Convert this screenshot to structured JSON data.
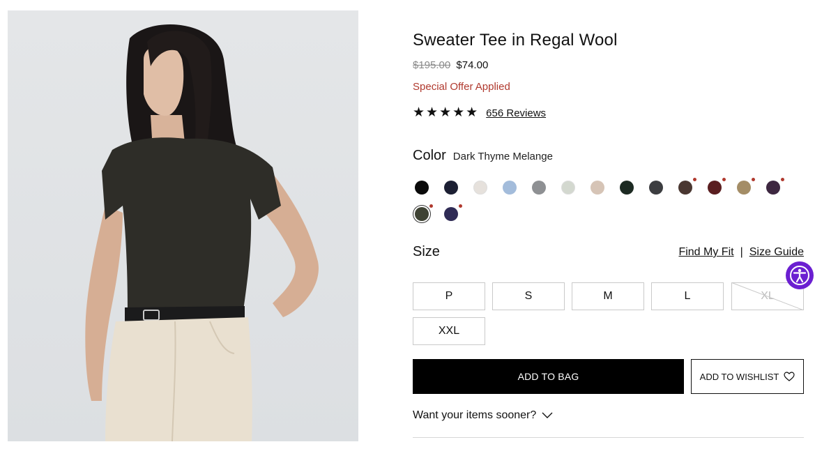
{
  "product": {
    "title": "Sweater Tee in Regal Wool",
    "price_original": "$195.00",
    "price_sale": "$74.00",
    "offer_text": "Special Offer Applied",
    "rating_stars": "★★★★★",
    "rating_value": 5,
    "reviews_link": "656 Reviews"
  },
  "color": {
    "label": "Color",
    "selected_name": "Dark Thyme Melange",
    "swatches": [
      {
        "color": "#0a0a0a",
        "dot": false,
        "selected": false
      },
      {
        "color": "#1c1f33",
        "dot": false,
        "selected": false
      },
      {
        "color": "#e6e1dc",
        "dot": false,
        "selected": false
      },
      {
        "color": "#a3bcdb",
        "dot": false,
        "selected": false
      },
      {
        "color": "#8e9093",
        "dot": false,
        "selected": false
      },
      {
        "color": "#d3d8cf",
        "dot": false,
        "selected": false
      },
      {
        "color": "#d6c4b6",
        "dot": false,
        "selected": false
      },
      {
        "color": "#1c2a22",
        "dot": false,
        "selected": false
      },
      {
        "color": "#3c3d40",
        "dot": false,
        "selected": false
      },
      {
        "color": "#4a3731",
        "dot": true,
        "selected": false
      },
      {
        "color": "#5a1e20",
        "dot": true,
        "selected": false
      },
      {
        "color": "#a48d66",
        "dot": true,
        "selected": false
      },
      {
        "color": "#3d2740",
        "dot": true,
        "selected": false
      },
      {
        "color": "#3e4233",
        "dot": true,
        "selected": true
      },
      {
        "color": "#2f2b55",
        "dot": true,
        "selected": false
      }
    ]
  },
  "size": {
    "label": "Size",
    "find_my_fit": "Find My Fit",
    "separator": "|",
    "size_guide": "Size Guide",
    "options": [
      {
        "label": "P",
        "available": true
      },
      {
        "label": "S",
        "available": true
      },
      {
        "label": "M",
        "available": true
      },
      {
        "label": "L",
        "available": true
      },
      {
        "label": "XL",
        "available": false
      },
      {
        "label": "XXL",
        "available": true
      }
    ]
  },
  "actions": {
    "add_to_bag": "ADD TO BAG",
    "add_to_wishlist": "ADD TO WISHLIST"
  },
  "delivery": {
    "sooner_text": "Want your items sooner?"
  },
  "icons": {
    "wishlist": "heart-icon",
    "expand": "chevron-down-icon",
    "accessibility": "accessibility-icon"
  },
  "colors": {
    "accent_red": "#b0392e",
    "accessibility_purple": "#6b1fd1"
  }
}
